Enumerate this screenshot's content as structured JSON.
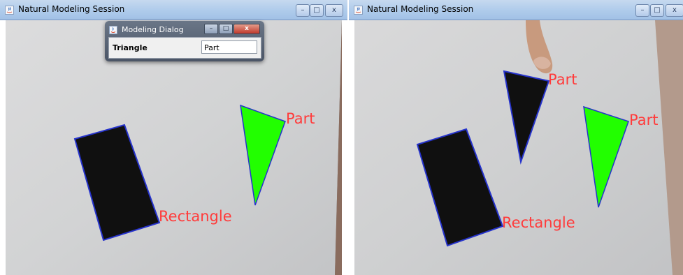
{
  "left_window": {
    "title": "Natural Modeling Session",
    "labels": {
      "rectangle": "Rectangle",
      "part": "Part"
    }
  },
  "right_window": {
    "title": "Natural Modeling Session",
    "labels": {
      "rectangle": "Rectangle",
      "part_top": "Part",
      "part_right": "Part"
    }
  },
  "dialog": {
    "title": "Modeling Dialog",
    "row_label": "Triangle",
    "row_value": "Part"
  },
  "window_controls": {
    "minimize": "–",
    "maximize": "□",
    "close": "x"
  },
  "colors": {
    "label_red": "#ff3b3b",
    "triangle_green": "#22ff00",
    "shape_black": "#101010",
    "outline_blue": "#2633cc"
  },
  "icons": [
    "java-app-icon",
    "minimize-icon",
    "maximize-icon",
    "close-icon"
  ]
}
